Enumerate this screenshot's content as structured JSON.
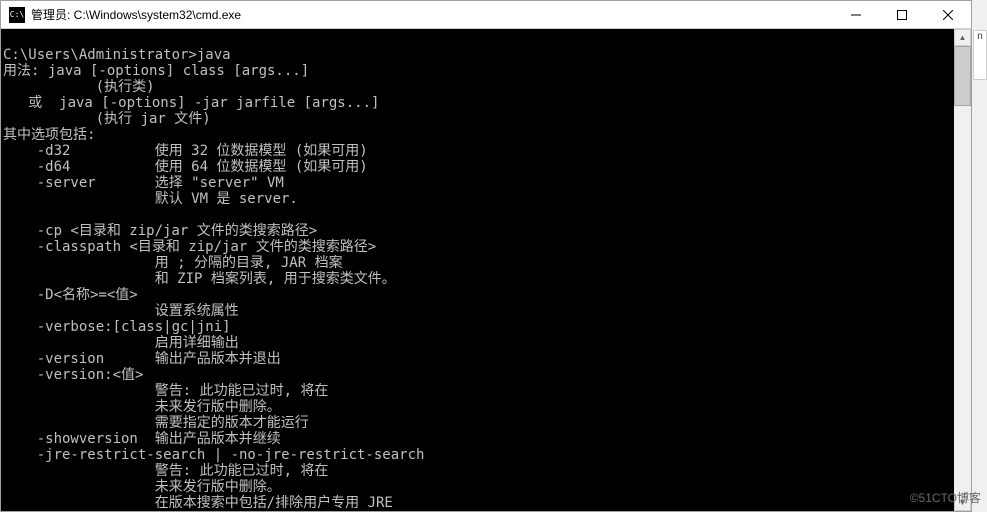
{
  "titlebar": {
    "icon_label": "C:\\",
    "title": "管理员: C:\\Windows\\system32\\cmd.exe"
  },
  "console": {
    "lines": [
      "",
      "C:\\Users\\Administrator>java",
      "用法: java [-options] class [args...]",
      "           (执行类)",
      "   或  java [-options] -jar jarfile [args...]",
      "           (执行 jar 文件)",
      "其中选项包括:",
      "    -d32          使用 32 位数据模型 (如果可用)",
      "    -d64          使用 64 位数据模型 (如果可用)",
      "    -server       选择 \"server\" VM",
      "                  默认 VM 是 server.",
      "",
      "    -cp <目录和 zip/jar 文件的类搜索路径>",
      "    -classpath <目录和 zip/jar 文件的类搜索路径>",
      "                  用 ; 分隔的目录, JAR 档案",
      "                  和 ZIP 档案列表, 用于搜索类文件。",
      "    -D<名称>=<值>",
      "                  设置系统属性",
      "    -verbose:[class|gc|jni]",
      "                  启用详细输出",
      "    -version      输出产品版本并退出",
      "    -version:<值>",
      "                  警告: 此功能已过时, 将在",
      "                  未来发行版中删除。",
      "                  需要指定的版本才能运行",
      "    -showversion  输出产品版本并继续",
      "    -jre-restrict-search | -no-jre-restrict-search",
      "                  警告: 此功能已过时, 将在",
      "                  未来发行版中删除。",
      "                  在版本搜索中包括/排除用户专用 JRE"
    ]
  },
  "watermark": "©51CTO博客",
  "side_sliver": "n"
}
